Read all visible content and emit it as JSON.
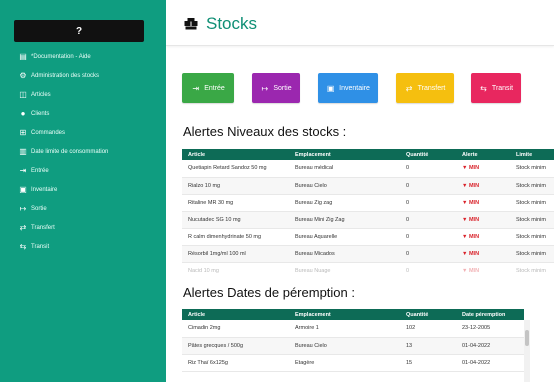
{
  "sidebar": {
    "logo_text": "?",
    "items": [
      {
        "label": "*Documentation - Aide",
        "icon": "book-icon"
      },
      {
        "label": "Administration des stocks",
        "icon": "settings-icon"
      },
      {
        "label": "Articles",
        "icon": "basket-icon"
      },
      {
        "label": "Clients",
        "icon": "user-icon"
      },
      {
        "label": "Commandes",
        "icon": "cart-icon"
      },
      {
        "label": "Date limite de consommation",
        "icon": "barcode-icon"
      },
      {
        "label": "Entrée",
        "icon": "sign-in-icon"
      },
      {
        "label": "Inventaire",
        "icon": "clipboard-icon"
      },
      {
        "label": "Sortie",
        "icon": "sign-out-icon"
      },
      {
        "label": "Transfert",
        "icon": "transfer-icon"
      },
      {
        "label": "Transit",
        "icon": "transit-icon"
      }
    ]
  },
  "header": {
    "title": "Stocks",
    "icon": "boxes-icon"
  },
  "actions": [
    {
      "label": "Entrée",
      "color": "#3aa846",
      "icon": "sign-in-icon"
    },
    {
      "label": "Sortie",
      "color": "#9b27af",
      "icon": "sign-out-icon"
    },
    {
      "label": "Inventaire",
      "color": "#2f90e6",
      "icon": "clipboard-icon"
    },
    {
      "label": "Transfert",
      "color": "#f5bf0f",
      "icon": "transfer-icon"
    },
    {
      "label": "Transit",
      "color": "#e8275f",
      "icon": "transit-icon"
    }
  ],
  "stock_alerts": {
    "heading": "Alertes Niveaux des stocks :",
    "columns": [
      "Article",
      "Emplacement",
      "Quantité",
      "Alerte",
      "Limite"
    ],
    "rows": [
      {
        "article": "Quetiapin Retard Sandoz 50 mg",
        "location": "Bureau médical",
        "qty": "0",
        "alert": "▼ MIN",
        "limit": "Stock minim"
      },
      {
        "article": "Rialzo 10 mg",
        "location": "Bureau Cielo",
        "qty": "0",
        "alert": "▼ MIN",
        "limit": "Stock minim"
      },
      {
        "article": "Ritaline MR 30 mg",
        "location": "Bureau Zig zag",
        "qty": "0",
        "alert": "▼ MIN",
        "limit": "Stock minim"
      },
      {
        "article": "Nucutadec SG 10 mg",
        "location": "Bureau Mini Zig Zag",
        "qty": "0",
        "alert": "▼ MIN",
        "limit": "Stock minim"
      },
      {
        "article": "R calm dimenhydrinate 50 mg",
        "location": "Bureau Aquarelle",
        "qty": "0",
        "alert": "▼ MIN",
        "limit": "Stock minim"
      },
      {
        "article": "Résorbil 1mg/ml 100 ml",
        "location": "Bureau Micados",
        "qty": "0",
        "alert": "▼ MIN",
        "limit": "Stock minim"
      },
      {
        "article": "Nacid 10 mg",
        "location": "Bureau Nuage",
        "qty": "0",
        "alert": "▼ MIN",
        "limit": "Stock minim"
      }
    ]
  },
  "expiry_alerts": {
    "heading": "Alertes Dates de péremption :",
    "columns": [
      "Article",
      "Emplacement",
      "Quantité",
      "Date péremption"
    ],
    "rows": [
      {
        "article": "Cimadin 2mg",
        "location": "Armoire 1",
        "qty": "102",
        "date": "23-12-2005"
      },
      {
        "article": "Pâtes grecques / 500g",
        "location": "Bureau Cielo",
        "qty": "13",
        "date": "01-04-2022"
      },
      {
        "article": "Riz Thaï 6x125g",
        "location": "Etagère",
        "qty": "15",
        "date": "01-04-2022"
      }
    ]
  }
}
